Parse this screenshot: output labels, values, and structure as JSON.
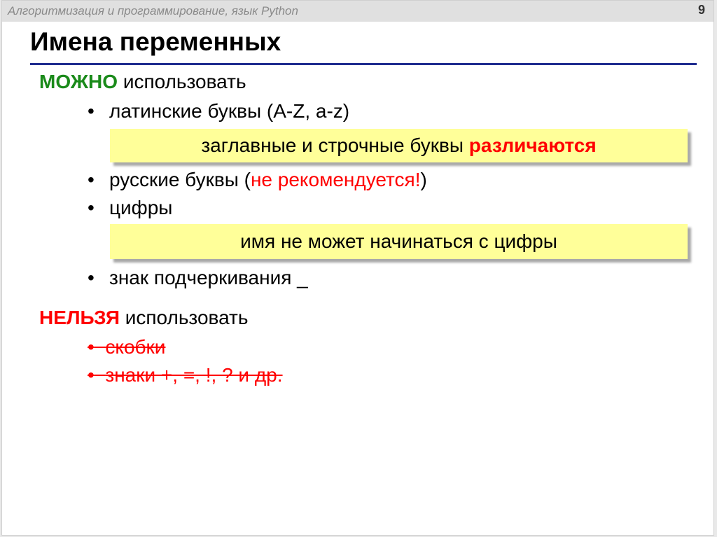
{
  "header": {
    "course_title": "Алгоритмизация и программирование, язык Python",
    "page_number": "9"
  },
  "title": "Имена переменных",
  "allowed": {
    "keyword": "МОЖНО",
    "rest": " использовать",
    "items": [
      "латинские буквы (A-Z, a-z)",
      "русские буквы (",
      "не рекомендуется!",
      ")",
      "цифры",
      "знак подчеркивания _"
    ]
  },
  "notes": {
    "case_prefix": "заглавные и строчные буквы ",
    "case_emph": "различаются",
    "digit_rule": "имя не может начинаться с цифры"
  },
  "forbidden": {
    "keyword": "НЕЛЬЗЯ",
    "rest": " использовать",
    "items": [
      "скобки",
      "знаки +, =, !, ? и др."
    ]
  },
  "bullet_symbol": "•",
  "colors": {
    "allowed": "#1a8a1a",
    "forbidden": "#ff0000",
    "note_bg": "#ffff99",
    "rule": "#1f2c8f"
  }
}
